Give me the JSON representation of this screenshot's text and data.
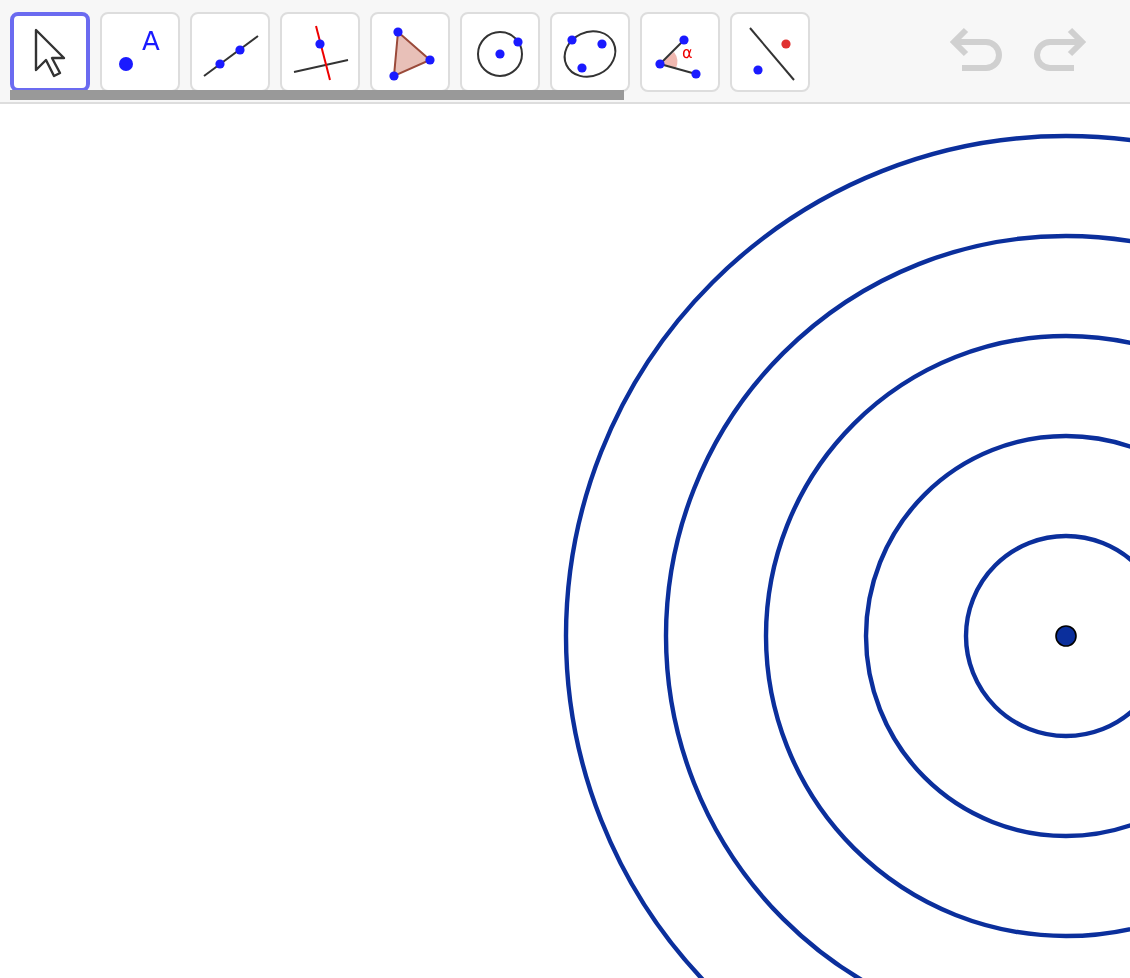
{
  "toolbar": {
    "tools": [
      {
        "kind": "move",
        "selected": true
      },
      {
        "kind": "point",
        "selected": false,
        "label": "A"
      },
      {
        "kind": "line",
        "selected": false
      },
      {
        "kind": "perpendicular",
        "selected": false
      },
      {
        "kind": "polygon",
        "selected": false
      },
      {
        "kind": "circle",
        "selected": false
      },
      {
        "kind": "conic",
        "selected": false
      },
      {
        "kind": "angle",
        "selected": false,
        "label": "α"
      },
      {
        "kind": "reflect",
        "selected": false
      }
    ],
    "undo": {
      "disabled": true
    },
    "redo": {
      "disabled": true
    }
  }
}
